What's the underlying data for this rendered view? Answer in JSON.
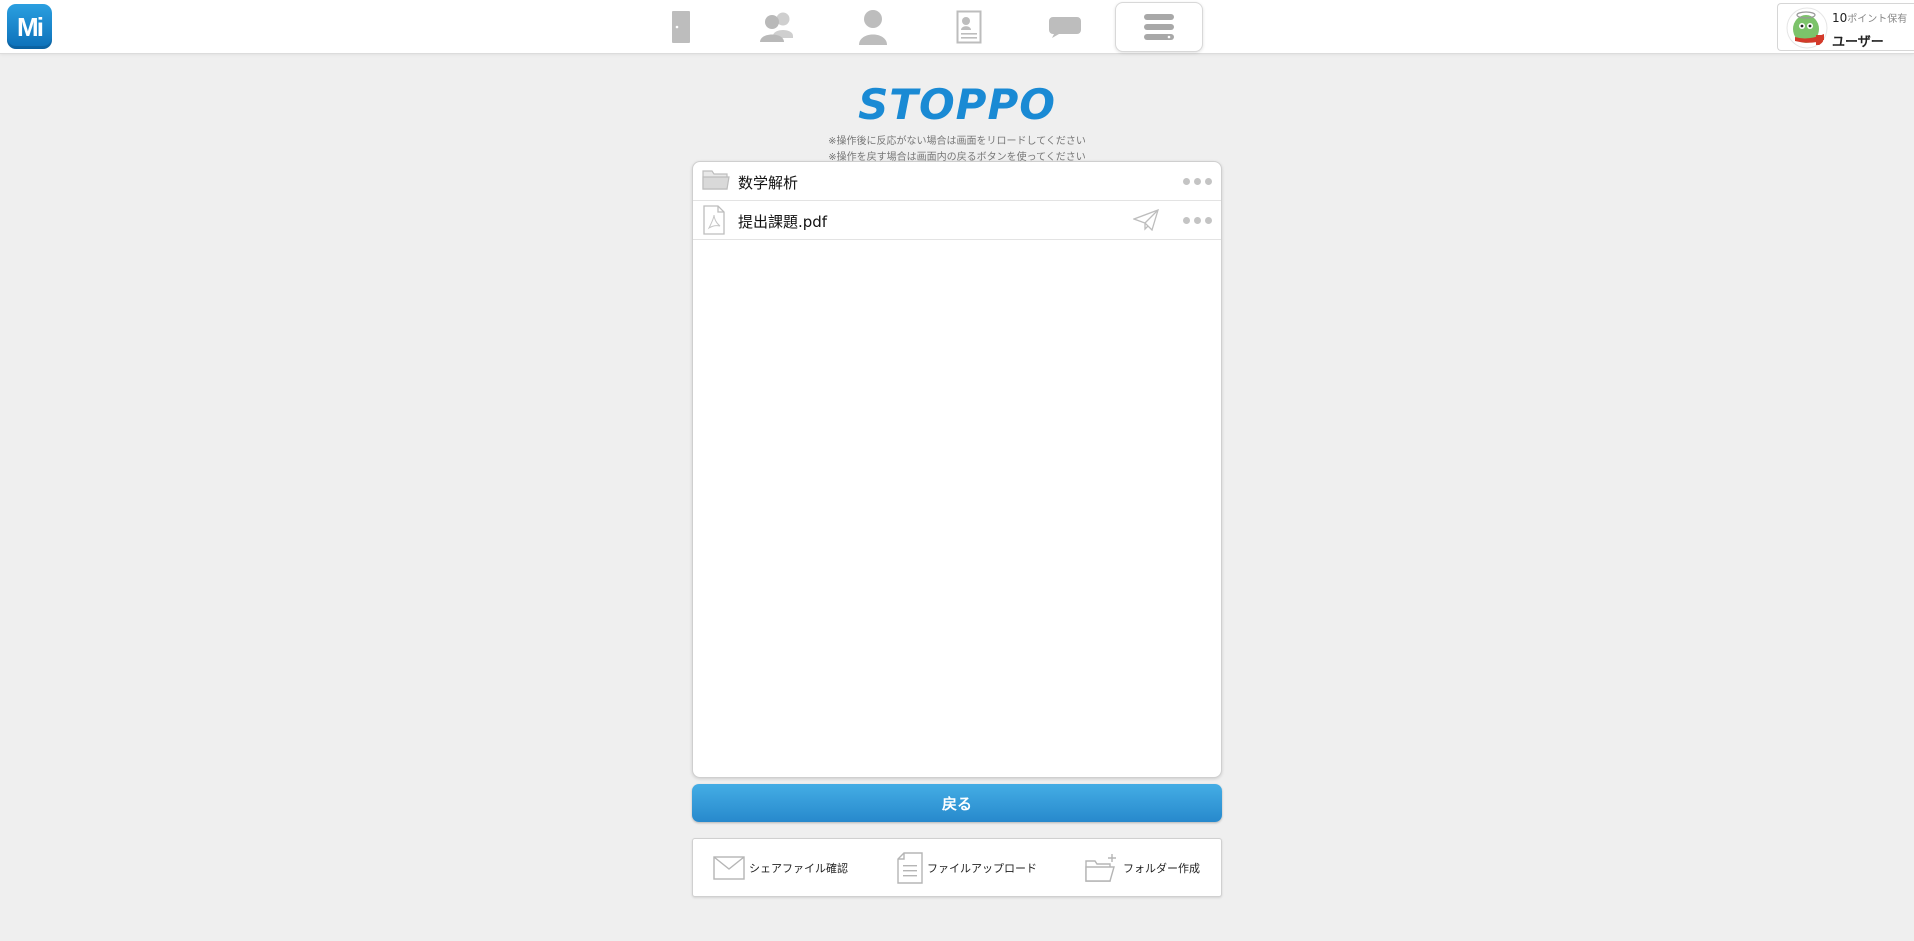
{
  "app": {
    "logo_text": "Mi",
    "accent_color": "#1a8ad4"
  },
  "nav": {
    "items": [
      {
        "name": "door-icon",
        "active": false
      },
      {
        "name": "group-icon",
        "active": false
      },
      {
        "name": "person-icon",
        "active": false
      },
      {
        "name": "id-card-icon",
        "active": false
      },
      {
        "name": "chat-icon",
        "active": false
      },
      {
        "name": "server-icon",
        "active": true
      }
    ]
  },
  "user": {
    "points_value": "10",
    "points_label": "ポイント保有",
    "name": "ユーザー"
  },
  "page": {
    "title": "STOPPO",
    "notice_1": "※操作後に反応がない場合は画面をリロードしてください",
    "notice_2": "※操作を戻す場合は画面内の戻るボタンを使ってください"
  },
  "files": [
    {
      "type": "folder",
      "name": "数学解析",
      "icon": "folder-icon",
      "shareable": false
    },
    {
      "type": "pdf",
      "name": "提出課題.pdf",
      "icon": "pdf-file-icon",
      "shareable": true
    }
  ],
  "buttons": {
    "back_label": "戻る"
  },
  "tools": {
    "share_check_label": "シェアファイル確認",
    "upload_label": "ファイルアップロード",
    "new_folder_label": "フォルダー作成"
  }
}
